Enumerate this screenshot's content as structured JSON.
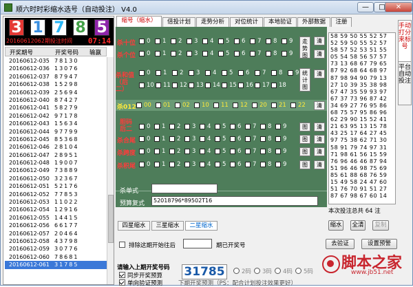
{
  "window": {
    "title": "顺六时时彩缩水选号（自动投注） V4.0",
    "min": "—",
    "max": "□",
    "close": "✕"
  },
  "current_draw": {
    "digits": [
      "3",
      "1",
      "7",
      "8",
      "5"
    ],
    "colors": [
      "#e53935",
      "#3a8fe0",
      "#29b6f6",
      "#43a047",
      "#8e24aa"
    ]
  },
  "countdown": {
    "label": "20160612062期投注时间",
    "time": "07:14"
  },
  "history_header": {
    "period": "开奖期号",
    "number": "开奖号码",
    "other": "输赢"
  },
  "history": [
    {
      "p": "20160612-035",
      "n": "78130"
    },
    {
      "p": "20160612-036",
      "n": "13076"
    },
    {
      "p": "20160612-037",
      "n": "87947"
    },
    {
      "p": "20160612-038",
      "n": "15298"
    },
    {
      "p": "20160612-039",
      "n": "25694"
    },
    {
      "p": "20160612-040",
      "n": "87427"
    },
    {
      "p": "20160612-041",
      "n": "58279"
    },
    {
      "p": "20160612-042",
      "n": "97178"
    },
    {
      "p": "20160612-043",
      "n": "15634"
    },
    {
      "p": "20160612-044",
      "n": "97799"
    },
    {
      "p": "20160612-045",
      "n": "85368"
    },
    {
      "p": "20160612-046",
      "n": "28104"
    },
    {
      "p": "20160612-047",
      "n": "28951"
    },
    {
      "p": "20160612-048",
      "n": "19007"
    },
    {
      "p": "20160612-049",
      "n": "73889"
    },
    {
      "p": "20160612-050",
      "n": "32367"
    },
    {
      "p": "20160612-051",
      "n": "52176"
    },
    {
      "p": "20160612-052",
      "n": "77853"
    },
    {
      "p": "20160612-053",
      "n": "11022"
    },
    {
      "p": "20160612-054",
      "n": "12916"
    },
    {
      "p": "20160612-055",
      "n": "14415"
    },
    {
      "p": "20160612-056",
      "n": "66177"
    },
    {
      "p": "20160612-057",
      "n": "20464"
    },
    {
      "p": "20160612-058",
      "n": "43798"
    },
    {
      "p": "20160612-059",
      "n": "30776"
    },
    {
      "p": "20160612-060",
      "n": "78681"
    },
    {
      "p": "20160612-061",
      "n": "31785",
      "sel": true
    }
  ],
  "tabs": [
    "缩号（缩水）",
    "倍投计划",
    "走势分析",
    "对位统计",
    "本地验证",
    "外部数据",
    "注册"
  ],
  "rows": {
    "shi": {
      "label": "杀十位"
    },
    "ge": {
      "label": "杀个位"
    },
    "digits": [
      "0",
      "1",
      "2",
      "3",
      "4",
      "5",
      "6",
      "7",
      "8",
      "9"
    ],
    "trend_btn": "走势图",
    "clear": "清",
    "hezhi": {
      "label": "杀和值（后二）",
      "nums": [
        "0",
        "1",
        "2",
        "3",
        "4",
        "5",
        "6",
        "7",
        "8",
        "9",
        "10",
        "11",
        "12",
        "13",
        "14",
        "15",
        "16",
        "17",
        "18"
      ]
    },
    "stat_btn": "统计图",
    "s012": {
      "label": "杀012",
      "items": [
        "00",
        "01",
        "02",
        "10",
        "11",
        "12",
        "20",
        "21",
        "22"
      ]
    },
    "dm": {
      "label": "胆码后二"
    },
    "wm": {
      "label": "杀合尾"
    },
    "kd": {
      "label": "杀跨度"
    },
    "jw": {
      "label": "杀积尾"
    },
    "tu": "图",
    "danshi": {
      "label": "杀单式",
      "value": ""
    },
    "fushi": {
      "label": "预算复式",
      "value": "52018796*89502T16"
    }
  },
  "subtabs": [
    "四星缩水",
    "三星缩水",
    "二星缩水"
  ],
  "right_numbers": [
    "58 59 50 55 52 57",
    "52 59 50 55 52 57",
    "58 57 52 53 51 55",
    "05 54 58 56 57 57",
    "73 13 68 67 79 65",
    "87 92 68 64 68 97",
    "87 98 94 90 79 13",
    "27 10 39 35 38 98",
    "67 47 35 59 93 97",
    "67 37 73 96 87 42",
    "34 69 27 76 95 86",
    "68 75 57 95 86 96",
    "62 29 90 15 52 41",
    "21 63 95 13 15 78",
    "43 25 17 64 27 45",
    "97 75 38 62 71 30",
    "58 91 79 74 97 31",
    "71 98 61 56 15 59",
    "76 96 46 46 87 94",
    "51 96 46 98 75 69",
    "85 61 88 68 76 59",
    "15 49 58 24 47 60",
    "51 76 70 91 51 27",
    "87 67 98 67 60 14"
  ],
  "side_tabs": [
    "手动打分来标号",
    "平台自动投注"
  ],
  "count_text": "本次投注总共 64 注",
  "buttons": {
    "shrink": "缩水",
    "clear_all": "全清",
    "copy": "复制",
    "verify": "去验证",
    "settings": "设置预警"
  },
  "exclude": {
    "label": "排除这期开始往后",
    "suffix": "期已开奖号"
  },
  "input_prev": {
    "label": "请输入上期开奖号码",
    "value": "31785"
  },
  "sync": {
    "label": "同步开奖预算",
    "checked": true
  },
  "auto": {
    "label": "单向验证预测",
    "checked": true
  },
  "radios": [
    "2码",
    "3码",
    "4码",
    "5码"
  ],
  "predict_text": "下期开奖预测（PS：配合计划投注效果更好）",
  "watermark": {
    "text": "脚本之家",
    "url": "www.jb51.net"
  }
}
